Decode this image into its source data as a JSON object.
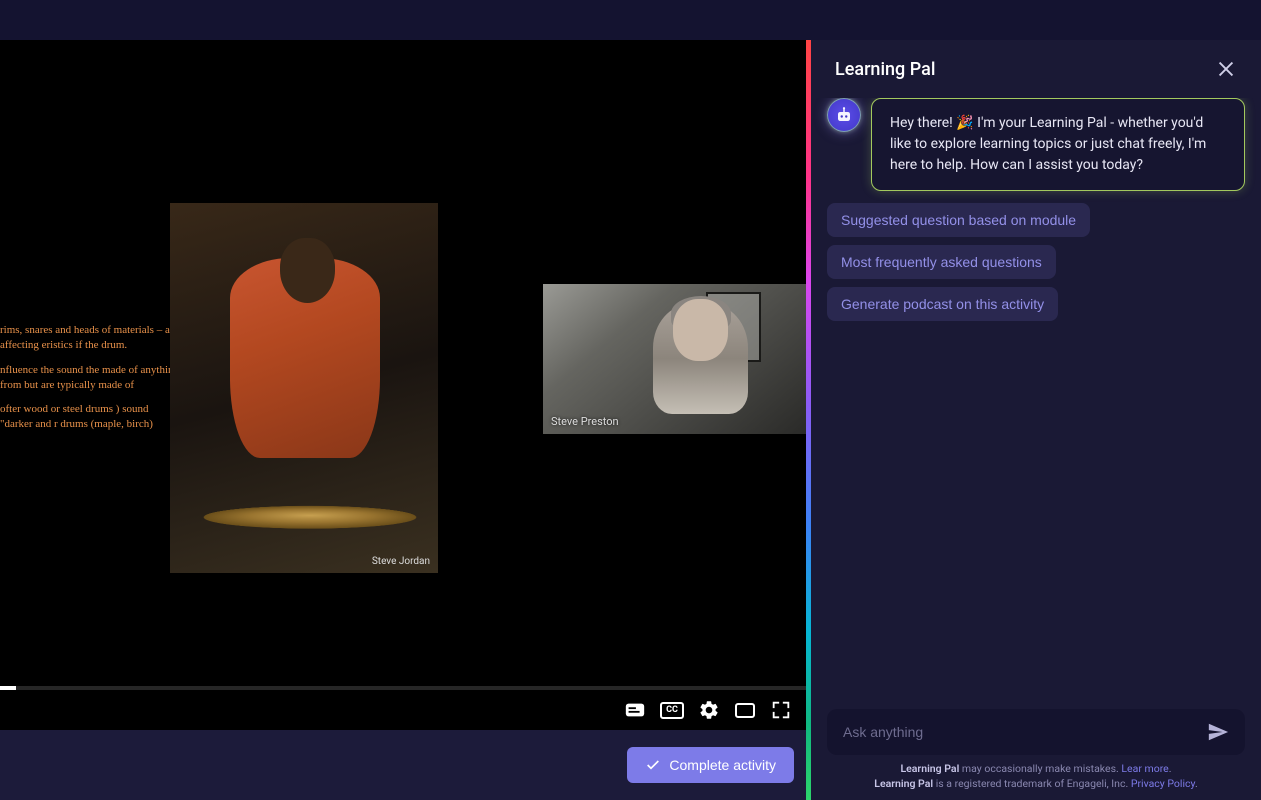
{
  "video": {
    "slide": {
      "text_lines": [
        "rims, snares and heads of materials – all affecting eristics if the drum.",
        "nfluence the sound the made of anything from but are typically made of",
        "ofter wood or steel drums ) sound \"darker and r drums (maple, birch)"
      ],
      "drummer_caption": "Steve Jordan"
    },
    "webcam_caption": "Steve Preston",
    "controls": {
      "cc_label": "CC"
    }
  },
  "complete_button_label": "Complete activity",
  "chat": {
    "title": "Learning Pal",
    "greeting": "Hey there! 🎉  I'm your Learning Pal - whether you'd like to explore learning topics or just chat freely, I'm here to help. How can I assist you today?",
    "suggestions": [
      "Suggested question based on module",
      "Most frequently asked questions",
      "Generate podcast on this activity"
    ],
    "input_placeholder": "Ask anything",
    "disclaimer": {
      "brand": "Learning Pal",
      "line1_rest": " may occasionally make mistakes. ",
      "learn_more": "Lear more",
      "line2_rest": " is a registered trademark of Engageli, Inc. ",
      "privacy": "Privacy Policy"
    }
  }
}
